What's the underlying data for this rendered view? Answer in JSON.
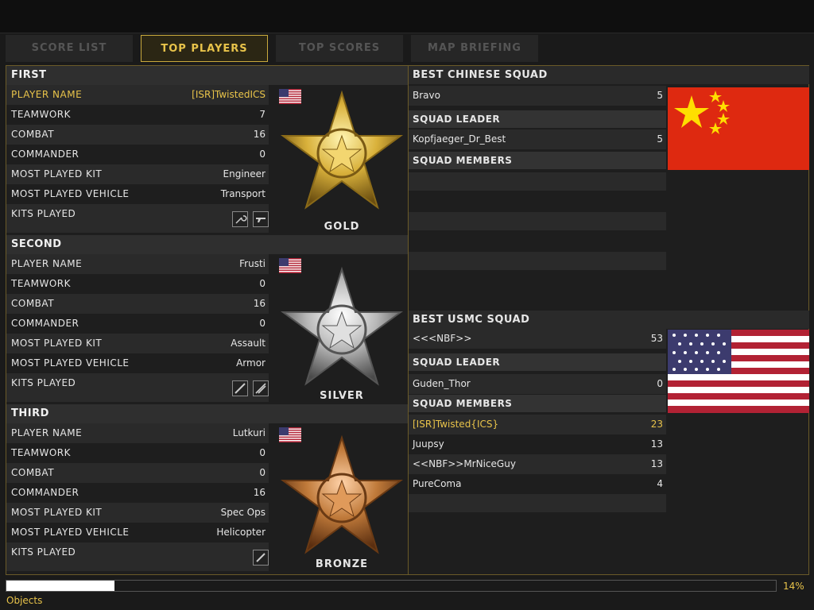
{
  "tabs": [
    {
      "label": "SCORE LIST"
    },
    {
      "label": "TOP PLAYERS"
    },
    {
      "label": "TOP SCORES"
    },
    {
      "label": "MAP BRIEFING"
    }
  ],
  "labels": {
    "player_name": "PLAYER NAME",
    "teamwork": "TEAMWORK",
    "combat": "COMBAT",
    "commander": "COMMANDER",
    "most_played_kit": "MOST PLAYED KIT",
    "most_played_vehicle": "MOST PLAYED VEHICLE",
    "kits_played": "KITS PLAYED",
    "squad_leader": "SQUAD LEADER",
    "squad_members": "SQUAD MEMBERS"
  },
  "players": {
    "first": {
      "header": "FIRST",
      "medal": "GOLD",
      "player_name": "[ISR]TwistedICS",
      "teamwork": "7",
      "combat": "16",
      "commander": "0",
      "most_played_kit": "Engineer",
      "most_played_vehicle": "Transport",
      "kits": [
        "wrench-kit-icon",
        "pistol-kit-icon"
      ]
    },
    "second": {
      "header": "SECOND",
      "medal": "SILVER",
      "player_name": "Frusti",
      "teamwork": "0",
      "combat": "16",
      "commander": "0",
      "most_played_kit": "Assault",
      "most_played_vehicle": "Armor",
      "kits": [
        "rifle-kit-icon",
        "launcher-kit-icon"
      ]
    },
    "third": {
      "header": "THIRD",
      "medal": "BRONZE",
      "player_name": "Lutkuri",
      "teamwork": "0",
      "combat": "0",
      "commander": "16",
      "most_played_kit": "Spec Ops",
      "most_played_vehicle": "Helicopter",
      "kits": [
        "knife-kit-icon"
      ]
    }
  },
  "chinese_squad": {
    "title": "BEST CHINESE SQUAD",
    "name": "Bravo",
    "score": "5",
    "leader": {
      "name": "Kopfjaeger_Dr_Best",
      "score": "5"
    },
    "members": []
  },
  "usmc_squad": {
    "title": "BEST USMC SQUAD",
    "name": "<<<NBF>>",
    "score": "53",
    "leader": {
      "name": "Guden_Thor",
      "score": "0"
    },
    "members": [
      {
        "name": "[ISR]Twisted{ICS}",
        "score": "23"
      },
      {
        "name": "Juupsy",
        "score": "13"
      },
      {
        "name": "<<NBF>>MrNiceGuy",
        "score": "13"
      },
      {
        "name": "PureComa",
        "score": "4"
      }
    ]
  },
  "progress": {
    "percent_label": "14%",
    "fraction": 0.14,
    "status": "Objects"
  },
  "colors": {
    "accent": "#e8c34a",
    "gold": "#d9b13b",
    "silver": "#c8c8c8",
    "bronze": "#c07a3a"
  }
}
